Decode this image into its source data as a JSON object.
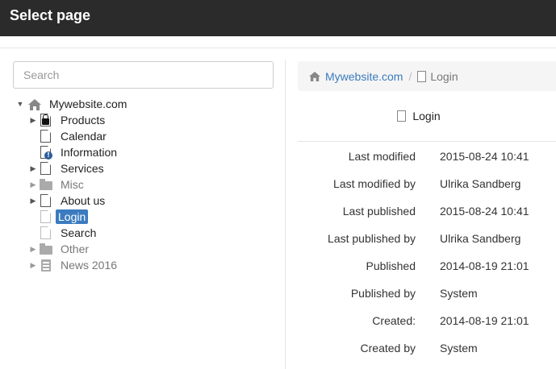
{
  "header": {
    "title": "Select page"
  },
  "search": {
    "placeholder": "Search"
  },
  "tree": [
    {
      "label": "Mywebsite.com",
      "icon": "home-icon",
      "caret": "expanded",
      "level": 0
    },
    {
      "label": "Products",
      "icon": "locked-page-icon",
      "caret": "collapsed",
      "level": 1
    },
    {
      "label": "Calendar",
      "icon": "page-icon",
      "caret": "none",
      "level": 1
    },
    {
      "label": "Information",
      "icon": "info-page-icon",
      "caret": "none",
      "level": 1
    },
    {
      "label": "Services",
      "icon": "page-icon",
      "caret": "collapsed",
      "level": 1
    },
    {
      "label": "Misc",
      "icon": "folder-icon",
      "caret": "collapsed",
      "level": 1
    },
    {
      "label": "About us",
      "icon": "page-icon",
      "caret": "collapsed",
      "level": 1
    },
    {
      "label": "Login",
      "icon": "page-icon",
      "caret": "none",
      "level": 1,
      "selected": true
    },
    {
      "label": "Search",
      "icon": "page-icon",
      "caret": "none",
      "level": 1
    },
    {
      "label": "Other",
      "icon": "folder-icon",
      "caret": "collapsed",
      "level": 1
    },
    {
      "label": "News 2016",
      "icon": "news-icon",
      "caret": "collapsed",
      "level": 1
    }
  ],
  "breadcrumb": {
    "root": "Mywebsite.com",
    "separator": "/",
    "current": "Login"
  },
  "page": {
    "title": "Login"
  },
  "meta": [
    {
      "key": "Last modified",
      "value": "2015-08-24 10:41"
    },
    {
      "key": "Last modified by",
      "value": "Ulrika Sandberg"
    },
    {
      "key": "Last published",
      "value": "2015-08-24 10:41"
    },
    {
      "key": "Last published by",
      "value": "Ulrika Sandberg"
    },
    {
      "key": "Published",
      "value": "2014-08-19 21:01"
    },
    {
      "key": "Published by",
      "value": "System"
    },
    {
      "key": "Created:",
      "value": "2014-08-19 21:01"
    },
    {
      "key": "Created by",
      "value": "System"
    }
  ],
  "colors": {
    "header_bg": "#2b2b2b",
    "accent": "#3b7bbf",
    "selected_bg": "#3b7bbf"
  }
}
